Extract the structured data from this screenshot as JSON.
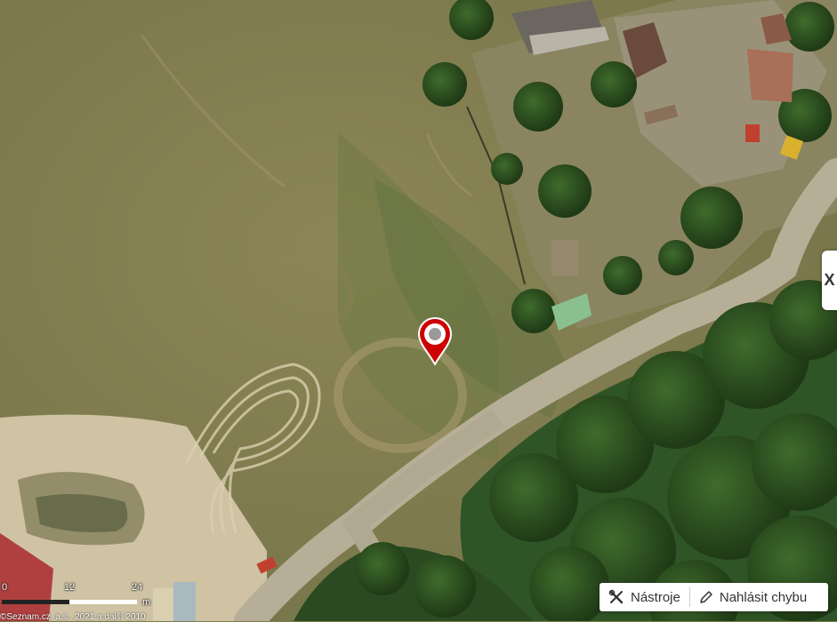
{
  "map": {
    "type": "aerial",
    "marker": {
      "icon": "location-pin-icon",
      "color": "#cc0000"
    }
  },
  "side_panel": {
    "toggle_label": "X"
  },
  "scale": {
    "ticks": [
      "0",
      "12",
      "24"
    ],
    "unit": "m"
  },
  "copyright": "©Seznam.cz, a.s., 2021 a další 2010",
  "toolbar": {
    "tools_label": "Nástroje",
    "tools_icon": "tools-icon",
    "report_label": "Nahlásit chybu",
    "report_icon": "pencil-icon"
  }
}
